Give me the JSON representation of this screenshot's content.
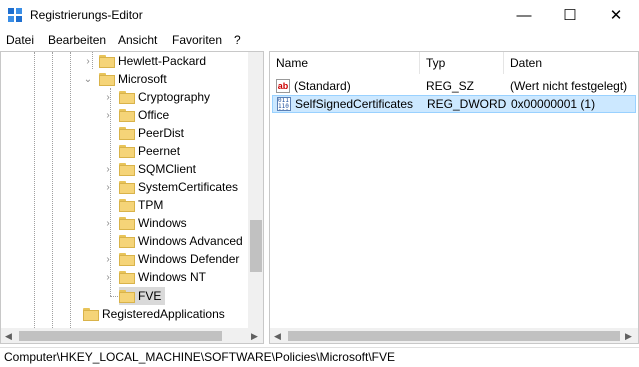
{
  "window": {
    "title": "Registrierungs-Editor",
    "minimize_glyph": "—",
    "maximize_glyph": "☐",
    "close_glyph": "✕"
  },
  "menu": {
    "items": [
      "Datei",
      "Bearbeiten",
      "Ansicht",
      "Favoriten",
      "?"
    ]
  },
  "tree": {
    "items": [
      {
        "label": "Hewlett-Packard",
        "expander": "›"
      },
      {
        "label": "Microsoft",
        "expander": "⌄"
      },
      {
        "label": "Cryptography",
        "expander": "›"
      },
      {
        "label": "Office",
        "expander": "›"
      },
      {
        "label": "PeerDist",
        "expander": ""
      },
      {
        "label": "Peernet",
        "expander": ""
      },
      {
        "label": "SQMClient",
        "expander": "›"
      },
      {
        "label": "SystemCertificates",
        "expander": "›"
      },
      {
        "label": "TPM",
        "expander": ""
      },
      {
        "label": "Windows",
        "expander": "›"
      },
      {
        "label": "Windows Advanced",
        "expander": ""
      },
      {
        "label": "Windows Defender",
        "expander": "›"
      },
      {
        "label": "Windows NT",
        "expander": "›"
      },
      {
        "label": "FVE",
        "expander": ""
      },
      {
        "label": "RegisteredApplications",
        "expander": ""
      }
    ],
    "selected": "FVE"
  },
  "list": {
    "columns": [
      "Name",
      "Typ",
      "Daten"
    ],
    "rows": [
      {
        "name": "(Standard)",
        "type": "REG_SZ",
        "data": "(Wert nicht festgelegt)",
        "icon": "string-value-icon"
      },
      {
        "name": "SelfSignedCertificates",
        "type": "REG_DWORD",
        "data": "0x00000001 (1)",
        "icon": "binary-value-icon"
      }
    ]
  },
  "statusbar": {
    "path": "Computer\\HKEY_LOCAL_MACHINE\\SOFTWARE\\Policies\\Microsoft\\FVE"
  },
  "colors": {
    "selection": "#cce8ff",
    "folder": "#f5d478"
  }
}
